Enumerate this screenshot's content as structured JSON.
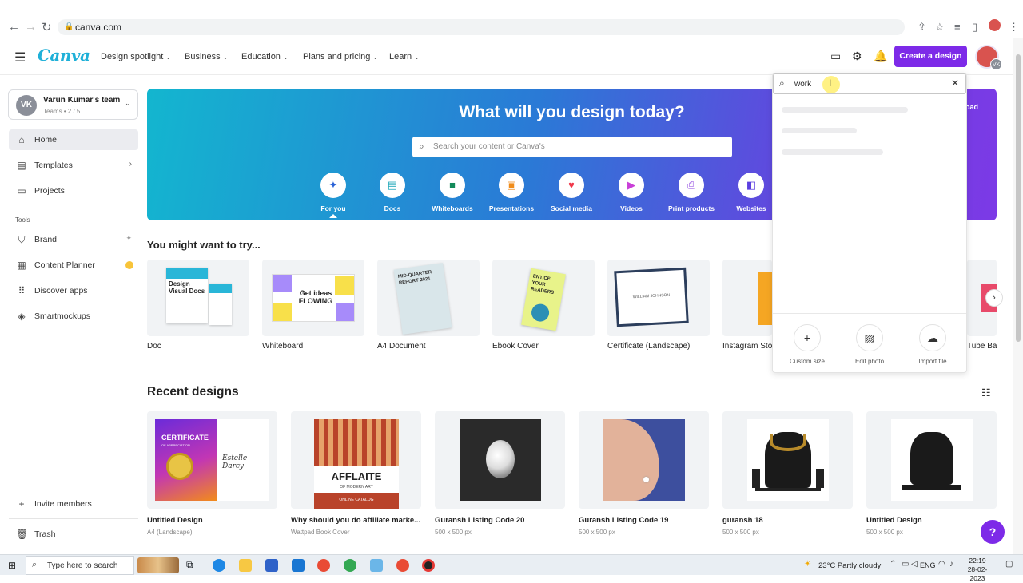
{
  "browser": {
    "url": "canva.com"
  },
  "header": {
    "logo": "Canva",
    "nav": [
      {
        "label": "Design spotlight"
      },
      {
        "label": "Business"
      },
      {
        "label": "Education"
      },
      {
        "label": "Plans and pricing"
      },
      {
        "label": "Learn"
      }
    ],
    "create_label": "Create a design",
    "avatar_initials": "VK"
  },
  "sidebar": {
    "team_initials": "VK",
    "team_name": "Varun Kumar's team",
    "team_sub": "Teams • 2 / 5",
    "items": [
      {
        "label": "Home"
      },
      {
        "label": "Templates"
      },
      {
        "label": "Projects"
      }
    ],
    "tools_label": "Tools",
    "tools": [
      {
        "label": "Brand"
      },
      {
        "label": "Content Planner"
      },
      {
        "label": "Discover apps"
      },
      {
        "label": "Smartmockups"
      }
    ],
    "invite_label": "Invite members",
    "trash_label": "Trash"
  },
  "hero": {
    "title": "What will you design today?",
    "search_placeholder": "Search your content or Canva's",
    "categories": [
      {
        "label": "For you",
        "icon": "sparkle-icon",
        "color": "#2a62d6"
      },
      {
        "label": "Docs",
        "icon": "doc-icon",
        "color": "#1aa6b7"
      },
      {
        "label": "Whiteboards",
        "icon": "whiteboard-icon",
        "color": "#138a5a"
      },
      {
        "label": "Presentations",
        "icon": "presentation-icon",
        "color": "#f08c1a"
      },
      {
        "label": "Social media",
        "icon": "heart-icon",
        "color": "#f0384a"
      },
      {
        "label": "Videos",
        "icon": "video-icon",
        "color": "#c93fd8"
      },
      {
        "label": "Print products",
        "icon": "print-icon",
        "color": "#8b3fe0"
      },
      {
        "label": "Websites",
        "icon": "website-icon",
        "color": "#5b3fe0"
      }
    ],
    "upload_fragment": "oad"
  },
  "try_section": {
    "title": "You might want to try...",
    "cards": [
      {
        "label": "Doc"
      },
      {
        "label": "Whiteboard"
      },
      {
        "label": "A4 Document"
      },
      {
        "label": "Ebook Cover"
      },
      {
        "label": "Certificate (Landscape)"
      },
      {
        "label": "Instagram Sto"
      },
      {
        "label": "Tube Ba"
      }
    ],
    "thumb_text": {
      "doc": "Design Visual Docs",
      "whiteboard": "Get ideas FLOWING",
      "a4": "MID-QUARTER REPORT 2021",
      "ebook": "ENTICE YOUR READERS",
      "certificate": "WILLIAM JOHNSON"
    }
  },
  "recent": {
    "title": "Recent designs",
    "items": [
      {
        "title": "Untitled Design",
        "sub": "A4 (Landscape)"
      },
      {
        "title": "Why should you do affiliate marke...",
        "sub": "Wattpad Book Cover"
      },
      {
        "title": "Guransh Listing Code 20",
        "sub": "500 x 500 px"
      },
      {
        "title": "Guransh Listing Code 19",
        "sub": "500 x 500 px"
      },
      {
        "title": "guransh 18",
        "sub": "500 x 500 px"
      },
      {
        "title": "Untitled Design",
        "sub": "500 x 500 px"
      }
    ],
    "thumb_text": {
      "cert_title": "CERTIFICATE",
      "cert_sub": "OF APPRECIATION",
      "cert_name": "Estelle Darcy",
      "affiliate_title": "AFFLAITE",
      "affiliate_sub": "OF MODERN ART",
      "affiliate_caption": "ONLINE CATALOG"
    }
  },
  "search_panel": {
    "query": "work",
    "quick_actions": [
      {
        "label": "Custom size",
        "icon": "plus-icon"
      },
      {
        "label": "Edit photo",
        "icon": "image-icon"
      },
      {
        "label": "Import file",
        "icon": "upload-cloud-icon"
      }
    ]
  },
  "help_label": "?",
  "taskbar": {
    "search_text": "Type here to search",
    "weather": "23°C  Partly cloudy",
    "lang": "ENG",
    "time": "22:19",
    "date": "28-02-2023"
  }
}
